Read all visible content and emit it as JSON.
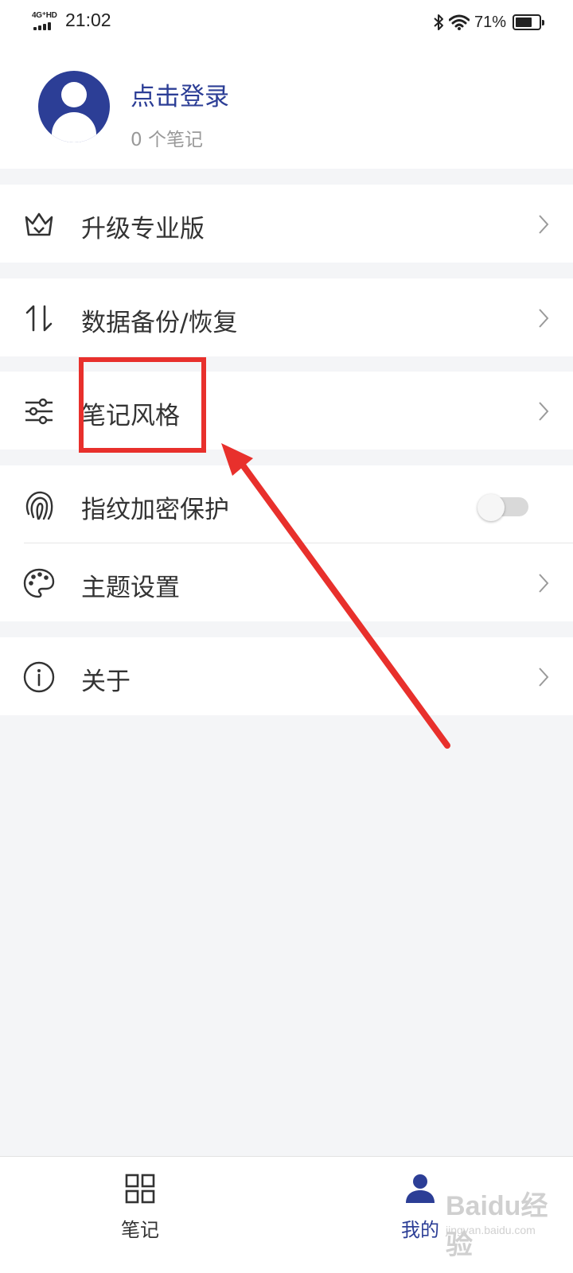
{
  "status_bar": {
    "network": "4G⁺HD",
    "time": "21:02",
    "battery_percent": "71%",
    "battery_level": 0.71
  },
  "profile": {
    "login_label": "点击登录",
    "note_count": "0 个笔记",
    "avatar_color": "#2c3e96"
  },
  "menu": {
    "upgrade": {
      "label": "升级专业版",
      "icon": "crown-icon"
    },
    "backup": {
      "label": "数据备份/恢复",
      "icon": "sort-arrows-icon"
    },
    "note_style": {
      "label": "笔记风格",
      "icon": "sliders-icon"
    },
    "fingerprint": {
      "label": "指纹加密保护",
      "icon": "fingerprint-icon",
      "enabled": false
    },
    "theme": {
      "label": "主题设置",
      "icon": "palette-icon"
    },
    "about": {
      "label": "关于",
      "icon": "info-icon"
    }
  },
  "bottom_nav": {
    "notes": {
      "label": "笔记",
      "icon": "grid-icon",
      "active": false
    },
    "mine": {
      "label": "我的",
      "icon": "person-icon",
      "active": true
    }
  },
  "colors": {
    "accent": "#2c3e96",
    "annotation": "#e8302c",
    "background": "#f4f5f7"
  },
  "watermark": {
    "logo": "Baidu经验",
    "url": "jingyan.baidu.com"
  }
}
